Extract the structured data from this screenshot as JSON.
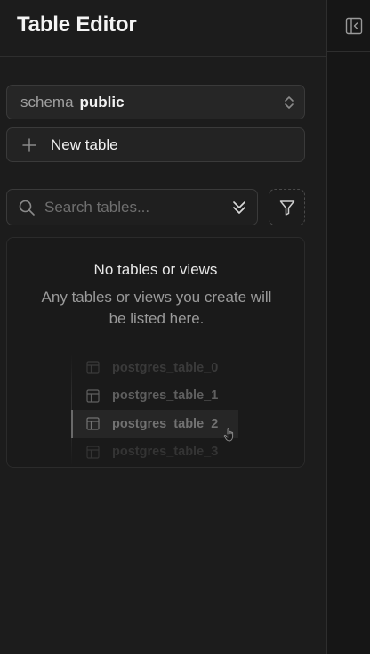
{
  "header": {
    "title": "Table Editor"
  },
  "schema_selector": {
    "label": "schema",
    "value": "public",
    "icon": "chevron-up-down-icon"
  },
  "new_table": {
    "label": "New table",
    "icon": "plus-icon"
  },
  "search": {
    "placeholder": "Search tables...",
    "value": "",
    "icon": "search-icon",
    "options_icon": "chevrons-down-icon"
  },
  "filter": {
    "icon": "filter-icon"
  },
  "empty_state": {
    "title": "No tables or views",
    "description": "Any tables or views you create will be listed here.",
    "preview_items": [
      {
        "label": "postgres_table_0"
      },
      {
        "label": "postgres_table_1"
      },
      {
        "label": "postgres_table_2"
      },
      {
        "label": "postgres_table_3"
      }
    ]
  },
  "right_panel": {
    "icon": "sidebar-collapse-icon"
  },
  "colors": {
    "background": "#1c1c1c",
    "panel": "#262626",
    "border": "#3a3a3a",
    "text": "#ededed",
    "muted": "#9a9a9a"
  }
}
